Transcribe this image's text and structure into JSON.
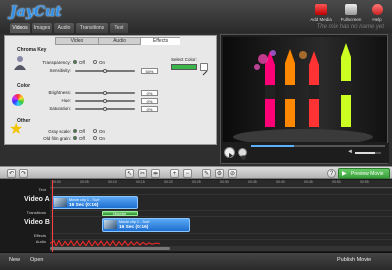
{
  "header": {
    "logo": "JayCut",
    "buttons": [
      {
        "label": "Add Media",
        "icon": "add-media-icon"
      },
      {
        "label": "Fullscreen",
        "icon": "fullscreen-icon"
      },
      {
        "label": "Help",
        "icon": "help-icon"
      }
    ],
    "motto": "The mix has no name yet",
    "tabs": [
      "Videos",
      "Images",
      "Audio",
      "Transitions",
      "Text"
    ],
    "active_tab": "Videos"
  },
  "panel": {
    "subtabs": [
      "Video",
      "Audio",
      "Effects"
    ],
    "active_subtab": "Effects",
    "chroma": {
      "heading": "Chroma Key",
      "transparency_label": "Transparency:",
      "sensitivity_label": "Sensitivity:",
      "off": "Off",
      "on": "On",
      "sensitivity_value": "50%",
      "select_color_label": "Select Color:",
      "color": "#39b54a"
    },
    "color": {
      "heading": "Color",
      "brightness_label": "Brightness:",
      "hue_label": "Hue:",
      "saturation_label": "Saturation:",
      "brightness_value": "0%",
      "hue_value": "0%",
      "saturation_value": "0%"
    },
    "other": {
      "heading": "Other",
      "grayscale_label": "Gray scale:",
      "oldfilm_label": "Old film grain:",
      "off": "Off",
      "on": "On"
    }
  },
  "toolbar": {
    "preview_label": "Preview Movie",
    "accent": "#3a9d3a"
  },
  "timeline": {
    "track_label_text": "Text",
    "track_label_video_a": "Video A",
    "track_label_transitions": "Transitions",
    "track_label_video_b": "Video B",
    "track_label_effects": "Effects",
    "track_label_audio": "Audio",
    "ruler_ticks": [
      "00:00",
      "00:05",
      "00:10",
      "00:15",
      "00:20",
      "00:25",
      "00:30",
      "00:35",
      "00:40",
      "00:45",
      "00:50",
      "00:55"
    ],
    "clip_a": {
      "title": "Movie clip 1 - Surf",
      "duration": "16 Sec (0:16)"
    },
    "clip_b": {
      "title": "Movie clip 1 - Surf",
      "duration": "16 Sec (0:16)"
    },
    "transition_label": "Dissolve"
  },
  "footer": {
    "new_label": "New",
    "open_label": "Open",
    "publish_label": "Publish Movie"
  },
  "colors": {
    "clip_blue": "#1e6fd0",
    "audio_wave": "#e02828",
    "transition_green": "#3aa83a"
  }
}
